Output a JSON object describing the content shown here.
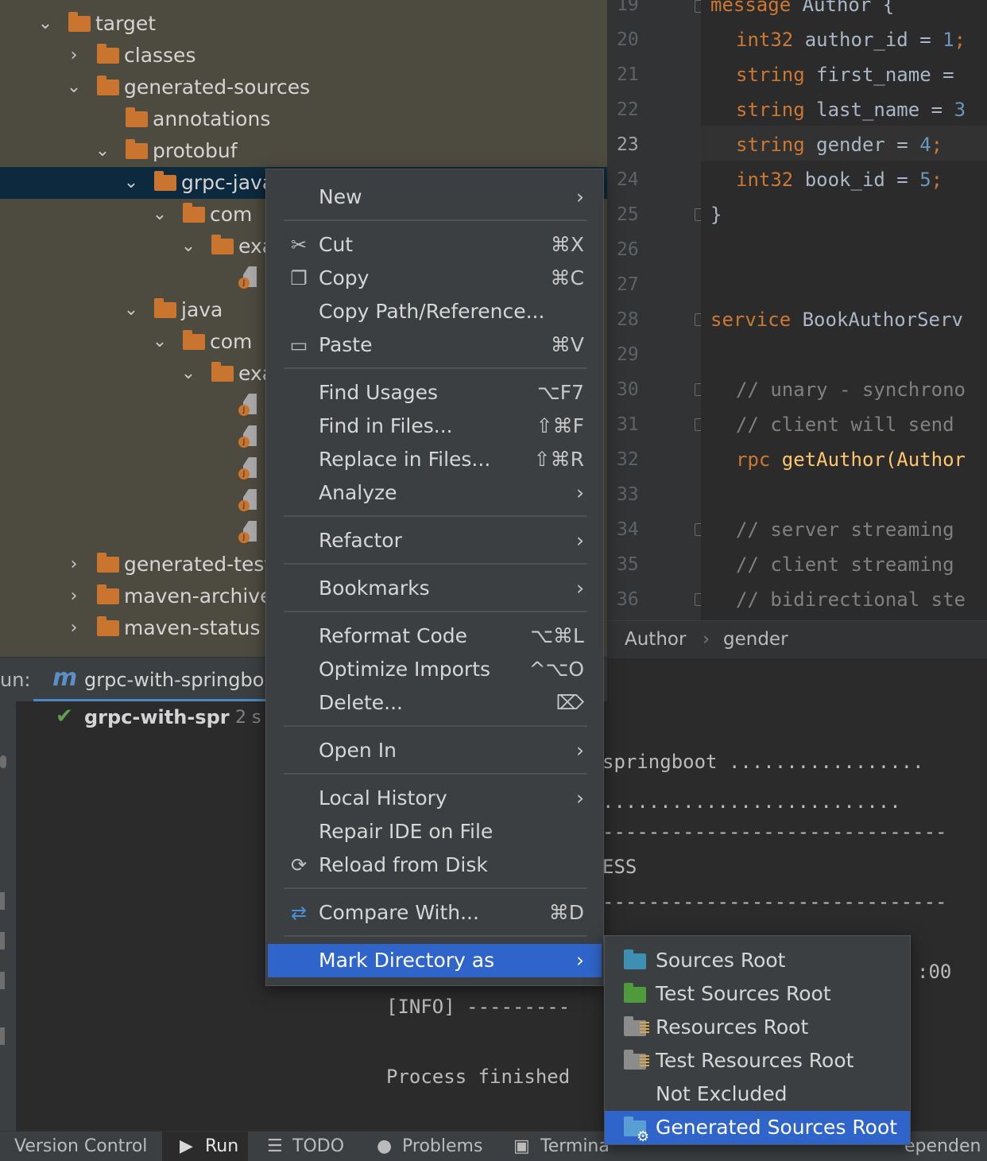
{
  "project_tree": {
    "rows": [
      {
        "label": "target",
        "expanded": true
      },
      {
        "label": "classes",
        "expanded": false
      },
      {
        "label": "generated-sources",
        "expanded": true
      },
      {
        "label": "annotations"
      },
      {
        "label": "protobuf",
        "expanded": true
      },
      {
        "label": "grpc-java",
        "expanded": true,
        "selected": true
      },
      {
        "label": "com",
        "expanded": true
      },
      {
        "label": "exa",
        "expanded": true
      },
      {
        "label": "java",
        "expanded": true
      },
      {
        "label": "com",
        "expanded": true
      },
      {
        "label": "exa",
        "expanded": true
      },
      {
        "label": "generated-test",
        "expanded": false
      },
      {
        "label": "maven-archive",
        "expanded": false
      },
      {
        "label": "maven-status",
        "expanded": false
      }
    ]
  },
  "editor": {
    "line_numbers": [
      "19",
      "20",
      "21",
      "22",
      "23",
      "24",
      "25",
      "26",
      "27",
      "28",
      "29",
      "30",
      "31",
      "32",
      "33",
      "34",
      "35",
      "36"
    ],
    "current_line": "23",
    "lines": [
      {
        "kw": "message",
        "rest": " Author {"
      },
      {
        "kw": "int32",
        "name": " author_id",
        "eq": " = ",
        "num": "1",
        "end": ";"
      },
      {
        "kw": "string",
        "name": " first_name",
        "eq": " =",
        "num": "",
        "end": ""
      },
      {
        "kw": "string",
        "name": " last_name",
        "eq": " = ",
        "num": "3",
        "end": ""
      },
      {
        "kw": "string",
        "name": " gender",
        "eq": " = ",
        "num": "4",
        "end": ";"
      },
      {
        "kw": "int32",
        "name": " book_id",
        "eq": " = ",
        "num": "5",
        "end": ";"
      },
      {
        "text": "}"
      },
      {
        "kw": "service",
        "rest": " BookAuthorServ"
      },
      {
        "comment": "// unary - synchrono"
      },
      {
        "comment": "// client will send"
      },
      {
        "kw": "rpc",
        "rest": " getAuthor(Author"
      },
      {
        "comment": "// server streaming"
      },
      {
        "comment": "// client streaming"
      },
      {
        "comment": "// bidirectional ste"
      }
    ],
    "breadcrumb": [
      "Author",
      "gender"
    ]
  },
  "run_panel": {
    "label": "un:",
    "tab": "grpc-with-springbo",
    "tree_item": "grpc-with-spr",
    "tree_item_time": "2 s",
    "console": [
      "springboot .................",
      "..........................",
      "------------------------------",
      "ESS",
      "------------------------------",
      ":00",
      "[INFO] ---------",
      "Process finished"
    ]
  },
  "context_menu": {
    "items": [
      {
        "label": "New",
        "submenu": true
      },
      {
        "label": "Cut",
        "shortcut": "⌘X",
        "icon": "scissors-icon"
      },
      {
        "label": "Copy",
        "shortcut": "⌘C",
        "icon": "copy-icon"
      },
      {
        "label": "Copy Path/Reference..."
      },
      {
        "label": "Paste",
        "shortcut": "⌘V",
        "icon": "clipboard-icon"
      },
      {
        "label": "Find Usages",
        "shortcut": "⌥F7"
      },
      {
        "label": "Find in Files...",
        "shortcut": "⇧⌘F"
      },
      {
        "label": "Replace in Files...",
        "shortcut": "⇧⌘R"
      },
      {
        "label": "Analyze",
        "submenu": true
      },
      {
        "label": "Refactor",
        "submenu": true
      },
      {
        "label": "Bookmarks",
        "submenu": true
      },
      {
        "label": "Reformat Code",
        "shortcut": "⌥⌘L"
      },
      {
        "label": "Optimize Imports",
        "shortcut": "^⌥O"
      },
      {
        "label": "Delete...",
        "shortcut": "⌦"
      },
      {
        "label": "Open In",
        "submenu": true
      },
      {
        "label": "Local History",
        "submenu": true
      },
      {
        "label": "Repair IDE on File"
      },
      {
        "label": "Reload from Disk",
        "icon": "reload-icon"
      },
      {
        "label": "Compare With...",
        "shortcut": "⌘D",
        "icon": "compare-icon"
      },
      {
        "label": "Mark Directory as",
        "submenu": true,
        "highlighted": true
      }
    ]
  },
  "submenu": {
    "items": [
      {
        "label": "Sources Root",
        "color": "#3d8fb3"
      },
      {
        "label": "Test Sources Root",
        "color": "#4f9a3a"
      },
      {
        "label": "Resources Root",
        "color": "#8c8c8c"
      },
      {
        "label": "Test Resources Root",
        "color": "#8c8c8c"
      },
      {
        "label": "Not Excluded"
      },
      {
        "label": "Generated Sources Root",
        "color": "#5a9fd4",
        "highlighted": true
      }
    ]
  },
  "status_bar": {
    "items": [
      "Version Control",
      "Run",
      "TODO",
      "Problems",
      "Termina",
      "ependen"
    ]
  },
  "colors": {
    "accent": "#2f65ca",
    "folder": "#c9742f",
    "selection": "#0d293e"
  }
}
